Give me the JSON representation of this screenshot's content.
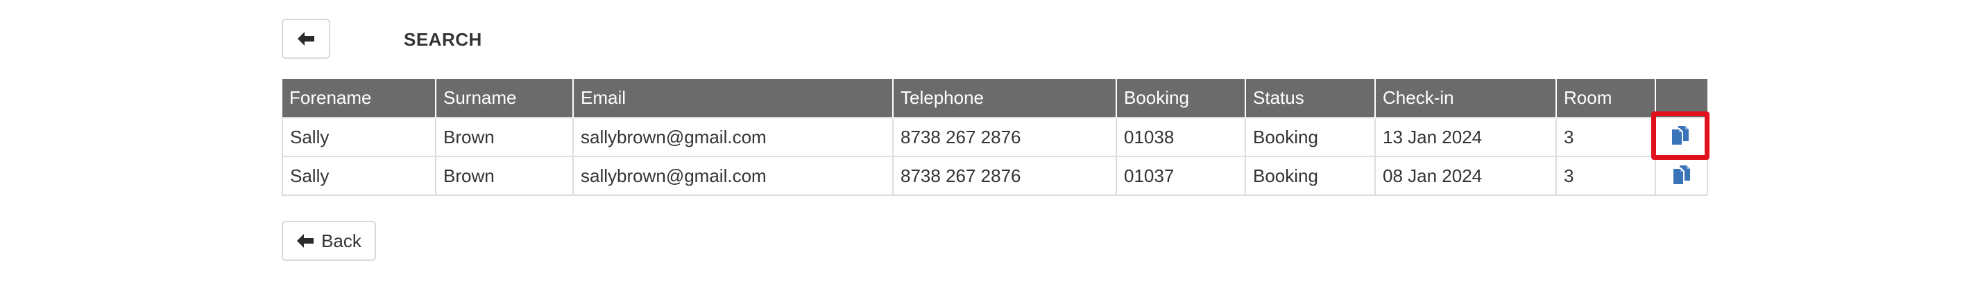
{
  "header": {
    "title": "SEARCH",
    "back_icon": "arrow-left-icon"
  },
  "table": {
    "columns": [
      "Forename",
      "Surname",
      "Email",
      "Telephone",
      "Booking",
      "Status",
      "Check-in",
      "Room",
      ""
    ],
    "rows": [
      {
        "forename": "Sally",
        "surname": "Brown",
        "email": "sallybrown@gmail.com",
        "telephone": "8738 267 2876",
        "booking": "01038",
        "status": "Booking",
        "checkin": "13 Jan 2024",
        "room": "3",
        "action_icon": "copy-icon",
        "highlighted": true
      },
      {
        "forename": "Sally",
        "surname": "Brown",
        "email": "sallybrown@gmail.com",
        "telephone": "8738 267 2876",
        "booking": "01037",
        "status": "Booking",
        "checkin": "08 Jan 2024",
        "room": "3",
        "action_icon": "copy-icon",
        "highlighted": false
      }
    ]
  },
  "footer": {
    "back_label": "Back",
    "back_icon": "arrow-left-icon"
  },
  "colors": {
    "header_bg": "#6b6b6b",
    "icon_blue": "#3a74b8",
    "highlight_red": "#e0101c"
  }
}
